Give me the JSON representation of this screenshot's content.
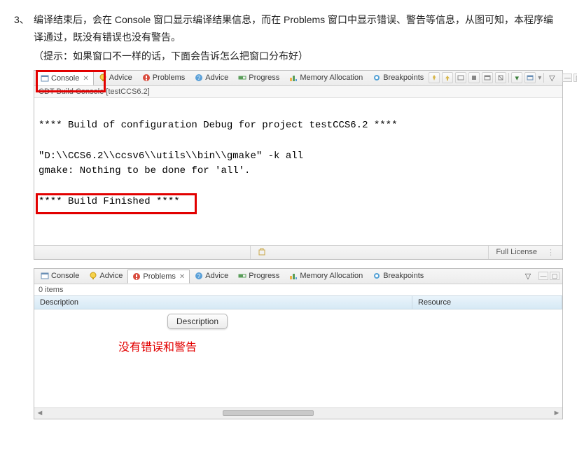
{
  "doc": {
    "number": "3、",
    "para": "编译结束后，会在 Console 窗口显示编译结果信息，而在 Problems 窗口中显示错误、警告等信息，从图可知，本程序编译通过，既没有错误也没有警告。",
    "hint": "（提示：如果窗口不一样的话，下面会告诉怎么把窗口分布好）"
  },
  "tabs": {
    "console": "Console",
    "advice1": "Advice",
    "problems": "Problems",
    "advice2": "Advice",
    "progress": "Progress",
    "memory": "Memory Allocation",
    "breakpoints": "Breakpoints"
  },
  "console": {
    "subtitle": "CDT Build Console [testCCS6.2]",
    "line1": "**** Build of configuration Debug for project testCCS6.2 ****",
    "line2": "\"D:\\\\CCS6.2\\\\ccsv6\\\\utils\\\\bin\\\\gmake\" -k all",
    "line3": "gmake: Nothing to be done for 'all'.",
    "line4": "**** Build Finished ****"
  },
  "status": {
    "full_license": "Full License"
  },
  "problems": {
    "items": "0 items",
    "col_desc": "Description",
    "col_res": "Resource",
    "tooltip": "Description",
    "note": "没有错误和警告"
  }
}
